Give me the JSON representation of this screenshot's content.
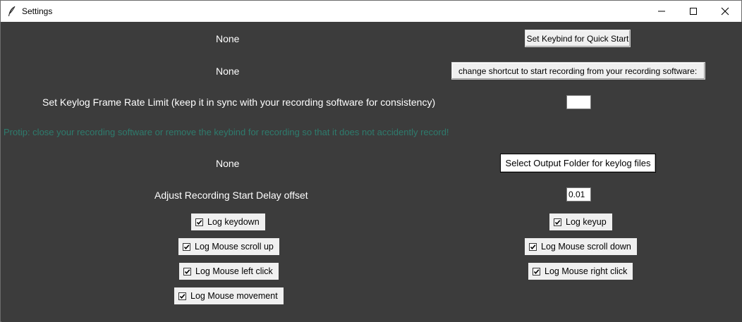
{
  "window": {
    "title": "Settings"
  },
  "rows": {
    "quick_start_value": "None",
    "quick_start_button": "Set Keybind for Quick Start",
    "recording_shortcut_value": "None",
    "recording_shortcut_button": "change shortcut to start recording from your recording software:",
    "frame_rate_label": "Set Keylog Frame Rate Limit (keep it in sync with your recording software for consistency)",
    "frame_rate_value": "",
    "protip": "Protip: close your recording software or remove the keybind for recording so that it does not accidently record!",
    "output_folder_value": "None",
    "output_folder_button": "Select Output Folder for keylog files",
    "delay_label": "Adjust Recording Start Delay offset",
    "delay_value": "0.01"
  },
  "checkboxes": {
    "keydown": {
      "label": "Log keydown",
      "checked": true
    },
    "keyup": {
      "label": "Log keyup",
      "checked": true
    },
    "scroll_up": {
      "label": "Log Mouse scroll up",
      "checked": true
    },
    "scroll_down": {
      "label": "Log Mouse scroll down",
      "checked": true
    },
    "left_click": {
      "label": "Log Mouse left click",
      "checked": true
    },
    "right_click": {
      "label": "Log Mouse right click",
      "checked": true
    },
    "movement": {
      "label": "Log Mouse movement",
      "checked": true
    }
  },
  "colors": {
    "background": "#3c3c3c",
    "tip_text": "#2e7b6d",
    "label_text": "#ffffff"
  }
}
